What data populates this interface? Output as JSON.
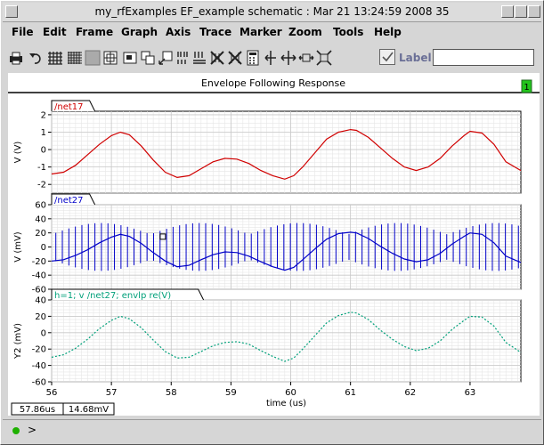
{
  "window": {
    "title": "my_rfExamples EF_example schematic : Mar 21 13:24:59 2008 35"
  },
  "menus": [
    "File",
    "Edit",
    "Frame",
    "Graph",
    "Axis",
    "Trace",
    "Marker",
    "Zoom",
    "Tools",
    "Help"
  ],
  "toolbar": {
    "icons": [
      "printer-icon",
      "undo-icon",
      "grid-icon",
      "fine-grid-icon",
      "blank-icon",
      "zoom-fit-icon",
      "fit-window-icon",
      "select-graph-icon",
      "select-frame-icon",
      "bar-mode-icon",
      "strip-mode-icon",
      "hide-traces-icon",
      "show-traces-icon",
      "calculator-icon",
      "split-vertical-icon",
      "fit-x-icon",
      "fit-y-icon",
      "fit-both-icon"
    ],
    "label_text": "Label",
    "label_value": ""
  },
  "plot": {
    "title": "Envelope Following Response",
    "badge": "1",
    "x_axis_label": "time (us)",
    "cursor_x": "57.86us",
    "cursor_y": "14.68mV",
    "colors": {
      "net17": "#d00000",
      "net27": "#0000c8",
      "envlp": "#00a07a"
    }
  },
  "chart_data": [
    {
      "type": "line",
      "title": "/net17",
      "xlabel": "time (us)",
      "ylabel": "V (V)",
      "xlim": [
        56,
        63.85
      ],
      "ylim": [
        -2.5,
        2.2
      ],
      "yticks": [
        -2,
        -1,
        0,
        1,
        2
      ],
      "x": [
        56,
        56.2,
        56.4,
        56.6,
        56.8,
        57,
        57.15,
        57.3,
        57.5,
        57.7,
        57.9,
        58.1,
        58.3,
        58.5,
        58.7,
        58.9,
        59.1,
        59.3,
        59.5,
        59.7,
        59.9,
        60.05,
        60.2,
        60.4,
        60.6,
        60.8,
        61,
        61.1,
        61.3,
        61.5,
        61.7,
        61.9,
        62.1,
        62.3,
        62.5,
        62.7,
        62.9,
        63,
        63.2,
        63.4,
        63.6,
        63.85
      ],
      "series": [
        {
          "name": "/net17",
          "values": [
            -1.4,
            -1.3,
            -0.9,
            -0.3,
            0.3,
            0.8,
            1.0,
            0.85,
            0.2,
            -0.6,
            -1.3,
            -1.6,
            -1.5,
            -1.1,
            -0.7,
            -0.5,
            -0.55,
            -0.8,
            -1.2,
            -1.5,
            -1.7,
            -1.5,
            -1.0,
            -0.2,
            0.6,
            1.0,
            1.15,
            1.1,
            0.7,
            0.1,
            -0.5,
            -1.0,
            -1.2,
            -1.0,
            -0.5,
            0.2,
            0.8,
            1.05,
            0.95,
            0.3,
            -0.7,
            -1.2
          ]
        }
      ]
    },
    {
      "type": "line",
      "title": "/net27",
      "xlabel": "time (us)",
      "ylabel": "V (mV)",
      "xlim": [
        56,
        63.85
      ],
      "ylim": [
        -60,
        60
      ],
      "yticks": [
        -60,
        -40,
        -20,
        0,
        20,
        40,
        60
      ],
      "x": [
        56,
        56.2,
        56.4,
        56.6,
        56.8,
        57,
        57.15,
        57.3,
        57.5,
        57.7,
        57.9,
        58.1,
        58.3,
        58.5,
        58.7,
        58.9,
        59.1,
        59.3,
        59.5,
        59.7,
        59.9,
        60.05,
        60.2,
        60.4,
        60.6,
        60.8,
        61,
        61.1,
        61.3,
        61.5,
        61.7,
        61.9,
        62.1,
        62.3,
        62.5,
        62.7,
        62.9,
        63,
        63.2,
        63.4,
        63.6,
        63.85
      ],
      "series": [
        {
          "name": "/net27",
          "values": [
            -20,
            -18,
            -12,
            -4,
            6,
            14,
            18,
            15,
            5,
            -8,
            -20,
            -28,
            -26,
            -18,
            -11,
            -7,
            -8,
            -13,
            -21,
            -28,
            -33,
            -29,
            -18,
            -3,
            11,
            19,
            21,
            20,
            12,
            1,
            -9,
            -17,
            -21,
            -18,
            -9,
            4,
            15,
            20,
            18,
            6,
            -13,
            -22
          ]
        }
      ],
      "marker": {
        "x": 57.86,
        "y": 14.68
      }
    },
    {
      "type": "line",
      "title": "h=1; v /net27; envlp re(V)",
      "xlabel": "time (us)",
      "ylabel": "Y2 (mV)",
      "xlim": [
        56,
        63.85
      ],
      "ylim": [
        -60,
        40
      ],
      "yticks": [
        -60,
        -40,
        -20,
        0,
        20,
        40
      ],
      "xticks": [
        56,
        57,
        58,
        59,
        60,
        61,
        62,
        63
      ],
      "x": [
        56,
        56.2,
        56.4,
        56.6,
        56.8,
        57,
        57.15,
        57.3,
        57.5,
        57.7,
        57.9,
        58.1,
        58.3,
        58.5,
        58.7,
        58.9,
        59.1,
        59.3,
        59.5,
        59.7,
        59.9,
        60.05,
        60.2,
        60.4,
        60.6,
        60.8,
        61,
        61.1,
        61.3,
        61.5,
        61.7,
        61.9,
        62.1,
        62.3,
        62.5,
        62.7,
        62.9,
        63,
        63.2,
        63.4,
        63.6,
        63.85
      ],
      "series": [
        {
          "name": "h=1; v /net27; envlp re(V)",
          "values": [
            -30,
            -27,
            -19,
            -8,
            5,
            15,
            20,
            17,
            6,
            -9,
            -23,
            -31,
            -30,
            -23,
            -16,
            -12,
            -11,
            -14,
            -22,
            -29,
            -35,
            -31,
            -20,
            -4,
            12,
            21,
            25,
            24,
            16,
            3,
            -8,
            -17,
            -22,
            -19,
            -10,
            4,
            15,
            20,
            19,
            8,
            -12,
            -24
          ]
        }
      ]
    }
  ]
}
